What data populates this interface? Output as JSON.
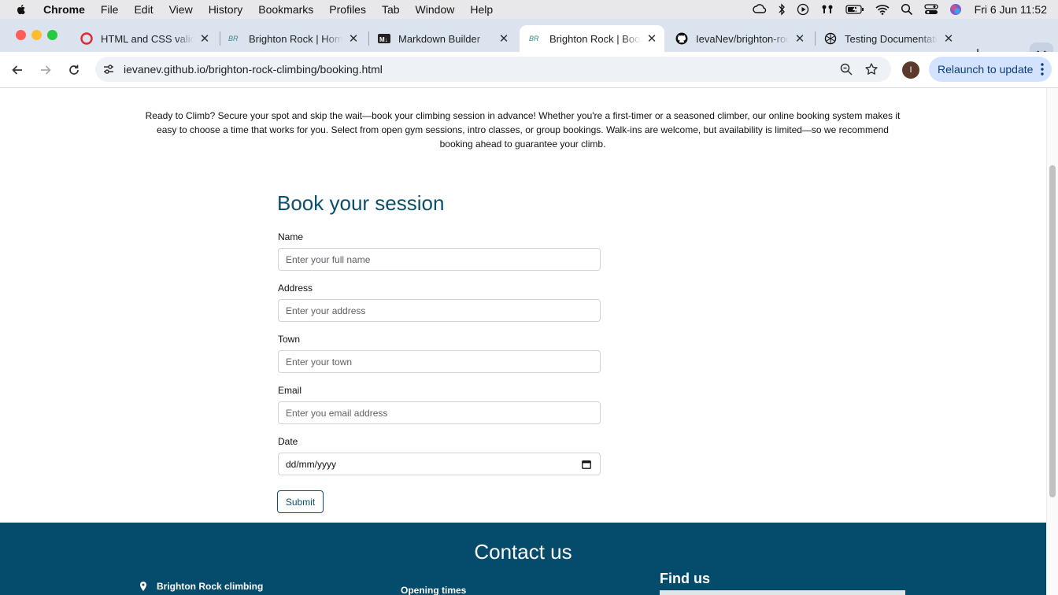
{
  "menubar": {
    "app_name": "Chrome",
    "menus": [
      "File",
      "Edit",
      "View",
      "History",
      "Bookmarks",
      "Profiles",
      "Tab",
      "Window",
      "Help"
    ],
    "clock": "Fri 6 Jun  11:52"
  },
  "tabs": [
    {
      "title": "HTML and CSS validator",
      "icon": "opera-icon"
    },
    {
      "title": "Brighton Rock | Home",
      "icon": "br-logo-icon"
    },
    {
      "title": "Markdown Builder",
      "icon": "markdown-icon"
    },
    {
      "title": "Brighton Rock | Booking",
      "icon": "br-logo-icon",
      "active": true
    },
    {
      "title": "IevaNev/brighton-rock",
      "icon": "github-icon"
    },
    {
      "title": "Testing Documentation",
      "icon": "chatgpt-icon"
    }
  ],
  "address_bar": {
    "host": "ievanev.github.io",
    "path": "/brighton-rock-climbing/booking.html"
  },
  "profile_initial": "I",
  "relaunch_label": "Relaunch to update",
  "page": {
    "intro": "Ready to Climb? Secure your spot and skip the wait—book your climbing session in advance! Whether you're a first-timer or a seasoned climber, our online booking system makes it easy to choose a time that works for you. Select from open gym sessions, intro classes, or group bookings. Walk-ins are welcome, but availability is limited—so we recommend booking ahead to guarantee your climb.",
    "form": {
      "heading": "Book your session",
      "fields": {
        "name": {
          "label": "Name",
          "placeholder": "Enter your full name"
        },
        "address": {
          "label": "Address",
          "placeholder": "Enter your address"
        },
        "town": {
          "label": "Town",
          "placeholder": "Enter your town"
        },
        "email": {
          "label": "Email",
          "placeholder": "Enter you email address"
        },
        "date": {
          "label": "Date",
          "value": "dd/mm/yyyy"
        }
      },
      "submit_label": "Submit"
    },
    "footer": {
      "heading": "Contact us",
      "brand": "Brighton Rock climbing",
      "opening_times_label": "Opening times",
      "find_us_heading": "Find us"
    }
  },
  "colors": {
    "brand_primary": "#0d4f6b",
    "footer_bg": "#054b6b",
    "tabstrip_bg": "#dbe3ef",
    "relaunch_bg": "#d3e3fd"
  }
}
